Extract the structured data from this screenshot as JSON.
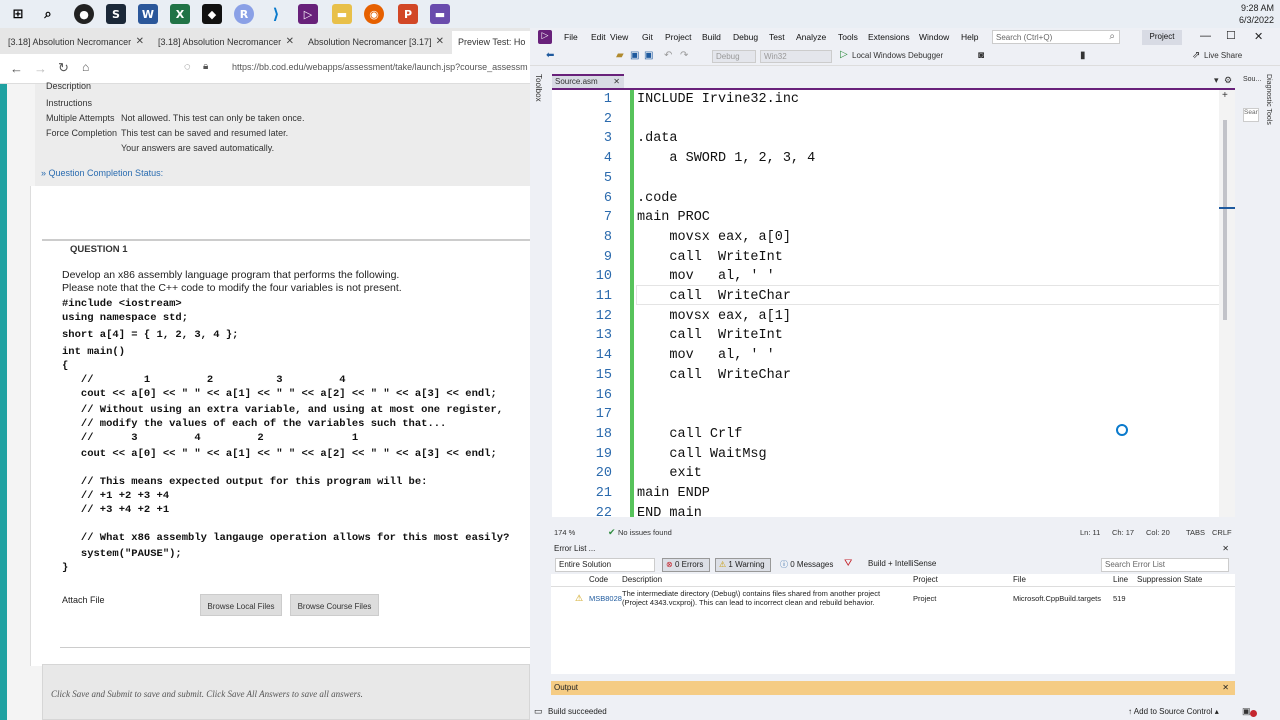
{
  "taskbar": {
    "time": "9:28 AM",
    "date": "6/3/2022"
  },
  "browser": {
    "tabs": [
      {
        "label": "[3.18] Absolution Necromancer"
      },
      {
        "label": "[3.18] Absolution Necromancer"
      },
      {
        "label": "Absolution Necromancer [3.17]"
      },
      {
        "label": "Preview Test: Ho"
      }
    ],
    "url": "https://bb.cod.edu/webapps/assessment/take/launch.jsp?course_assessm",
    "info": {
      "description": "Description",
      "instructions": "Instructions",
      "multiple_attempts_label": "Multiple Attempts",
      "multiple_attempts_value": "Not allowed. This test can only be taken once.",
      "force_completion_label": "Force Completion",
      "force_completion_value": "This test can be saved and resumed later.",
      "autosave": "Your answers are saved automatically."
    },
    "completion_status": "Question Completion Status:",
    "question_title": "QUESTION 1",
    "question_line1": "Develop an x86 assembly language program that performs the following.",
    "question_line2": "Please note that the C++ code to modify the four variables is not present.",
    "code_lines": [
      "#include <iostream>",
      "using namespace std;",
      "short a[4] = { 1, 2, 3, 4 };",
      "int main()",
      "{",
      "   //        1         2          3         4",
      "   cout << a[0] << \" \" << a[1] << \" \" << a[2] << \" \" << a[3] << endl;",
      "   // Without using an extra variable, and using at most one register,",
      "   // modify the values of each of the variables such that...",
      "   //      3         4         2              1",
      "   cout << a[0] << \" \" << a[1] << \" \" << a[2] << \" \" << a[3] << endl;",
      "",
      "   // This means expected output for this program will be:",
      "   // +1 +2 +3 +4",
      "   // +3 +4 +2 +1",
      "",
      "   // What x86 assembly langauge operation allows for this most easily?",
      "   system(\"PAUSE\");",
      "}"
    ],
    "attach_file": "Attach File",
    "browse_local": "Browse Local Files",
    "browse_course": "Browse Course Files",
    "footer_text": "Click Save and Submit to save and submit. Click Save All Answers to save all answers."
  },
  "vs": {
    "menu": [
      "File",
      "Edit",
      "View",
      "Git",
      "Project",
      "Build",
      "Debug",
      "Test",
      "Analyze",
      "Tools",
      "Extensions",
      "Window",
      "Help"
    ],
    "search_placeholder": "Search (Ctrl+Q)",
    "project_btn": "Project",
    "toolbar": {
      "config": "Debug",
      "platform": "Win32",
      "debugger": "Local Windows Debugger",
      "live_share": "Live Share"
    },
    "toolbox_label": "Toolbox",
    "diag_label": "Diagnostic Tools",
    "right_tab": "Sou...",
    "right_search": "Sear",
    "file_tab": "Source.asm",
    "code": [
      {
        "n": "1",
        "t": "INCLUDE Irvine32.inc"
      },
      {
        "n": "2",
        "t": ""
      },
      {
        "n": "3",
        "t": ".data"
      },
      {
        "n": "4",
        "t": "    a SWORD 1, 2, 3, 4"
      },
      {
        "n": "5",
        "t": ""
      },
      {
        "n": "6",
        "t": ".code"
      },
      {
        "n": "7",
        "t": "main PROC"
      },
      {
        "n": "8",
        "t": "    movsx eax, a[0]"
      },
      {
        "n": "9",
        "t": "    call  WriteInt"
      },
      {
        "n": "10",
        "t": "    mov   al, ' '"
      },
      {
        "n": "11",
        "t": "    call  WriteChar"
      },
      {
        "n": "12",
        "t": "    movsx eax, a[1]"
      },
      {
        "n": "13",
        "t": "    call  WriteInt"
      },
      {
        "n": "14",
        "t": "    mov   al, ' '"
      },
      {
        "n": "15",
        "t": "    call  WriteChar"
      },
      {
        "n": "16",
        "t": ""
      },
      {
        "n": "17",
        "t": ""
      },
      {
        "n": "18",
        "t": "    call Crlf"
      },
      {
        "n": "19",
        "t": "    call WaitMsg"
      },
      {
        "n": "20",
        "t": "    exit"
      },
      {
        "n": "21",
        "t": "main ENDP"
      },
      {
        "n": "22",
        "t": "END main"
      }
    ],
    "editor_status": {
      "zoom": "174 %",
      "issues": "No issues found",
      "ln": "Ln: 11",
      "ch": "Ch: 17",
      "col": "Col: 20",
      "tabs": "TABS",
      "crlf": "CRLF"
    },
    "error_list": {
      "title": "Error List ...",
      "scope": "Entire Solution",
      "errors": "0 Errors",
      "warnings": "1 Warning",
      "messages": "0 Messages",
      "build": "Build + IntelliSense",
      "search": "Search Error List",
      "columns": [
        "Code",
        "Description",
        "Project",
        "File",
        "Line",
        "Suppression State"
      ],
      "row": {
        "code": "MSB8028",
        "desc1": "The intermediate directory (Debug\\) contains files shared from another project",
        "desc2": "(Project 4343.vcxproj).  This can lead to incorrect clean and rebuild behavior.",
        "project": "Project",
        "file": "Microsoft.CppBuild.targets",
        "line": "519",
        "supp": ""
      }
    },
    "output_title": "Output",
    "status": "Build succeeded",
    "add_source": "Add to Source Control",
    "colors": {
      "accent": "#68217a",
      "output_bar": "#f5cc84",
      "gutter_green": "#57c35b",
      "line_number": "#2b6aad"
    }
  }
}
